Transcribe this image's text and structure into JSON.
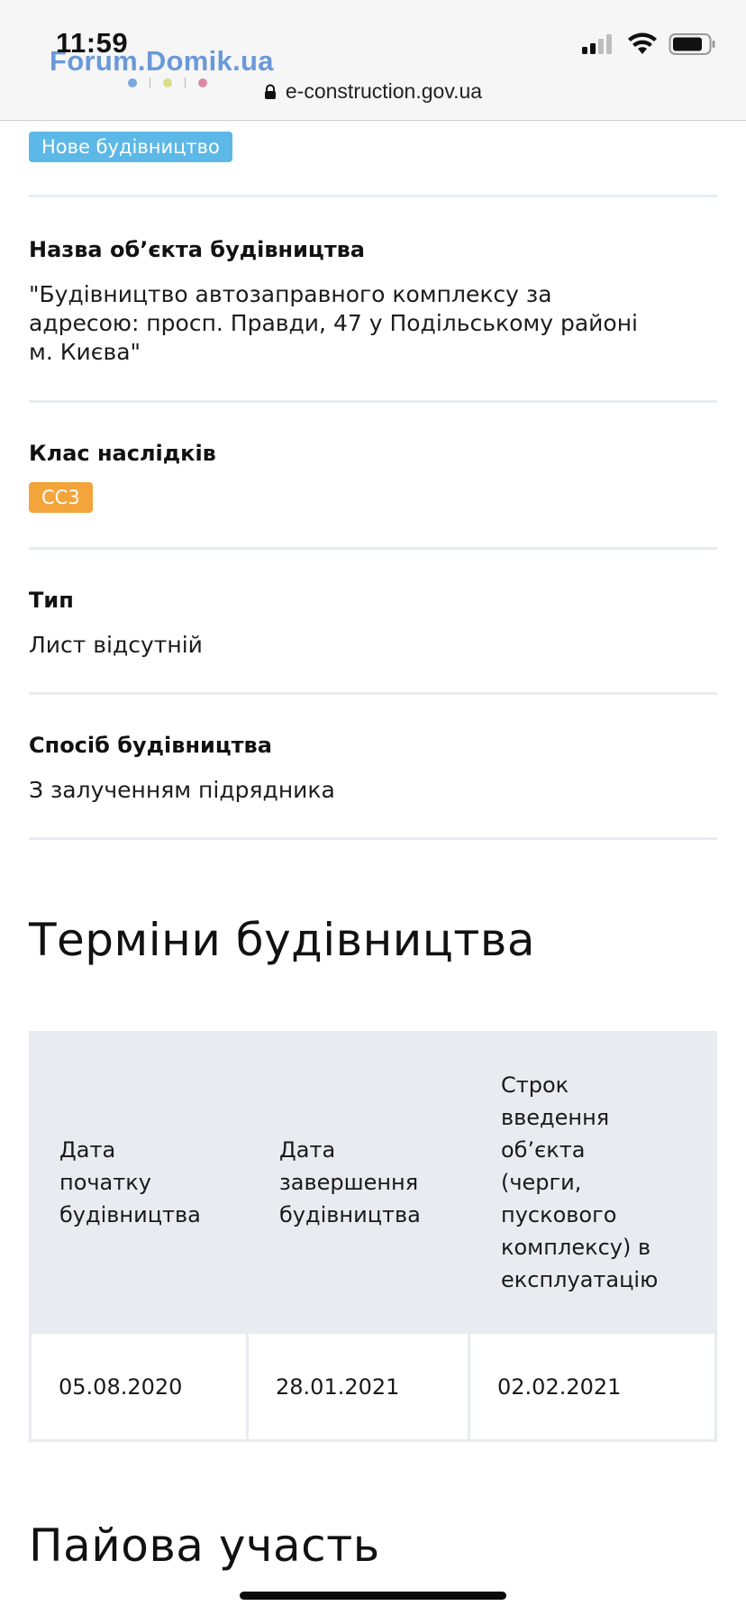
{
  "status_bar": {
    "time": "11:59",
    "watermark": "Forum.Domik.ua"
  },
  "browser": {
    "url": "e-construction.gov.ua"
  },
  "top_badge": "Нове будівництво",
  "fields": [
    {
      "label": "Назва об’єкта будівництва",
      "value_lines": [
        "\"Будівництво автозаправного комплексу за",
        "адресою: просп. Правди, 47 у Подільському районі",
        "м. Києва\""
      ]
    },
    {
      "label": "Клас наслідків",
      "badge": "СС3"
    },
    {
      "label": "Тип",
      "value": "Лист відсутній"
    },
    {
      "label": "Спосіб будівництва",
      "value": "З залученням підрядника"
    }
  ],
  "terms": {
    "title": "Терміни будівництва",
    "headers": [
      [
        "Дата",
        "початку",
        "будівництва"
      ],
      [
        "Дата",
        "завершення",
        "будівництва"
      ],
      [
        "Строк",
        "введення",
        "об’єкта",
        "(черги,",
        "пускового",
        "комплексу) в",
        "експлуатацію"
      ]
    ],
    "values": [
      "05.08.2020",
      "28.01.2021",
      "02.02.2021"
    ]
  },
  "next_section_title": "Пайова участь",
  "colors": {
    "badge_blue": "#5cb8e6",
    "badge_orange": "#f3a43a",
    "table_header_bg": "#e8ecf0",
    "divider": "#e7ecf1"
  }
}
